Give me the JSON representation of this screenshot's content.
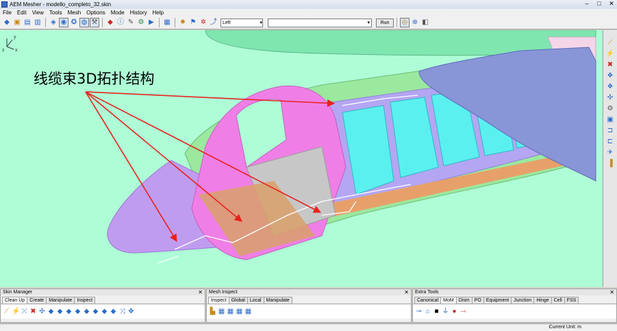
{
  "window": {
    "title": "AEM Mesher - modello_completo_32.skin",
    "minimize": "–",
    "maximize": "□",
    "close": "✕"
  },
  "menu": [
    "File",
    "Edit",
    "View",
    "Tools",
    "Mesh",
    "Options",
    "Mode",
    "History",
    "Help"
  ],
  "toolbar": {
    "group1": [
      "◆",
      "▣",
      "▤",
      "▥"
    ],
    "group2": [
      "◈",
      "◉",
      "✪",
      "◍",
      "⚒"
    ],
    "group3": [
      "◆",
      "ⓘ",
      "✎",
      "⚙",
      "▶"
    ],
    "grid": "▦",
    "group4": [
      "✹",
      "⚑",
      "✲",
      "⤴"
    ],
    "view_select": "Left",
    "view_arrow": "▾",
    "command_arrow": "▾",
    "run_label": "Run",
    "group5": [
      "◎",
      "⊕",
      "◧"
    ]
  },
  "viewport": {
    "annotation": "线缆束3D拓扑结构",
    "axis_x": "x",
    "axis_y": "y",
    "axis_z": "z"
  },
  "side_tools": [
    "⟋",
    "⚡",
    "✖",
    "❖",
    "❖",
    "✣",
    "⚙",
    "▣",
    "⊐",
    "⊏",
    "✈",
    "▐"
  ],
  "skin_manager": {
    "title": "Skin Manager",
    "close": "✕",
    "tabs": [
      "Clean Up",
      "Create",
      "Manipulate",
      "Inspect"
    ],
    "tools": [
      "⟋",
      "⚡",
      "⤫",
      "✖",
      "✣",
      "◆",
      "◆",
      "◆",
      "◆",
      "◆",
      "◆",
      "◆",
      "◆",
      "⤨",
      "✥"
    ]
  },
  "mesh_inspect": {
    "title": "Mesh Inspect",
    "close": "✕",
    "tabs": [
      "Inspect",
      "Global",
      "Local",
      "Manipulate"
    ],
    "tools": [
      "▙",
      "▦",
      "▦",
      "▦",
      "▦"
    ]
  },
  "extra_tools": {
    "title": "Extra Tools",
    "close": "✕",
    "tabs": [
      "Canonical",
      "MoM",
      "Dism",
      "PO",
      "Equipment",
      "Junction",
      "Hinge",
      "Cell",
      "FSS"
    ],
    "tools": [
      "⊸",
      "⌂",
      "■",
      "⏚",
      "●",
      "⤙"
    ]
  },
  "status": {
    "current_unit": "Current Unit: m"
  },
  "colors": {
    "background": "#aefdd6",
    "fuselage": "#ef7fe6",
    "wing": "#8895d6",
    "seats": "#5bf0f0",
    "arrows": "#e8221e"
  }
}
